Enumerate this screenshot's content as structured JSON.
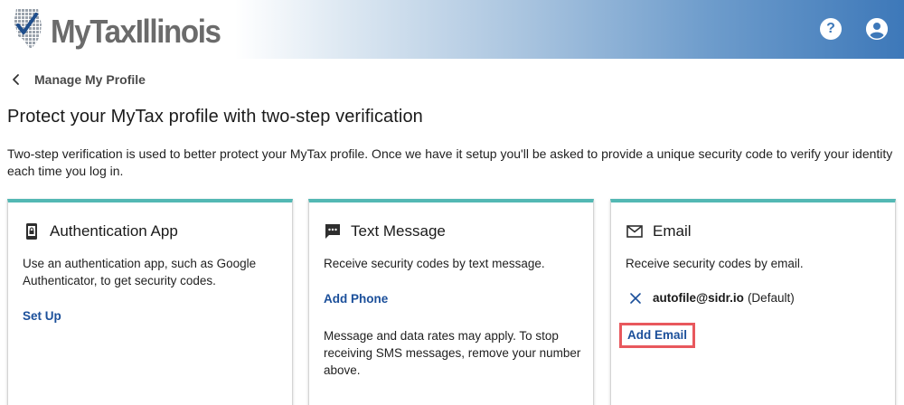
{
  "header": {
    "logo_text_my": "My",
    "logo_text_tax": "Tax",
    "logo_text_illinois": "Illinois",
    "help_icon": "question-circle-icon",
    "account_icon": "account-circle-icon"
  },
  "breadcrumb": {
    "back_icon": "chevron-left-icon",
    "label": "Manage My Profile"
  },
  "page": {
    "title": "Protect your MyTax profile with two-step verification",
    "intro": "Two-step verification is used to better protect your MyTax profile. Once we have it setup you'll be asked to provide a unique security code to verify your identity each time you log in."
  },
  "cards": [
    {
      "icon": "phone-lock-icon",
      "title": "Authentication App",
      "description": "Use an authentication app, such as Google Authenticator, to get security codes.",
      "link": "Set Up"
    },
    {
      "icon": "chat-bubble-icon",
      "title": "Text Message",
      "description": "Receive security codes by text message.",
      "link": "Add Phone",
      "note": "Message and data rates may apply. To stop receiving SMS messages, remove your number above."
    },
    {
      "icon": "mail-icon",
      "title": "Email",
      "description": "Receive security codes by email.",
      "email_address": "autofile@sidr.io",
      "email_default": "(Default)",
      "link": "Add Email"
    }
  ],
  "colors": {
    "accent_teal": "#53b8b4",
    "link_blue": "#1b4f9a",
    "highlight_red": "#e8585d",
    "header_blue": "#3d78b9"
  }
}
